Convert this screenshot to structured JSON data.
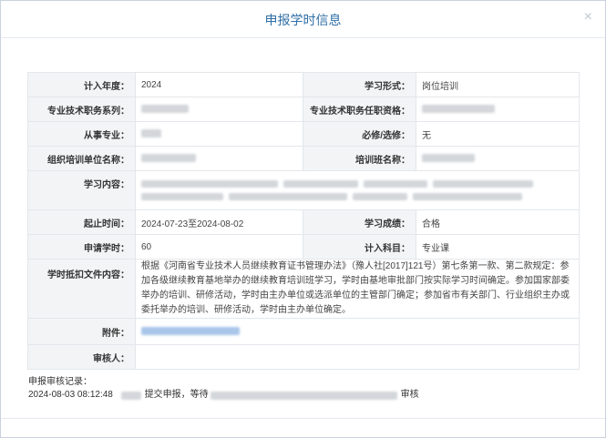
{
  "dialog": {
    "title": "申报学时信息",
    "close_glyph": "×"
  },
  "fields": {
    "year_label": "计入年度：",
    "year_value": "2024",
    "study_form_label": "学习形式：",
    "study_form_value": "岗位培训",
    "tech_series_label": "专业技术职务系列：",
    "tech_qual_label": "专业技术职务任职资格：",
    "major_label": "从事专业：",
    "required_label": "必修/选修：",
    "required_value": "无",
    "org_label": "组织培训单位名称：",
    "class_label": "培训班名称：",
    "content_label": "学习内容：",
    "period_label": "起止时间：",
    "period_value": "2024-07-23至2024-08-02",
    "result_label": "学习成绩：",
    "result_value": "合格",
    "hours_label": "申请学时：",
    "hours_value": "60",
    "subject_label": "计入科目：",
    "subject_value": "专业课",
    "basis_label": "学时抵扣文件内容：",
    "basis_value": "根据《河南省专业技术人员继续教育证书管理办法》（豫人社[2017]121号）第七条第一款、第二款规定：参加各级继续教育基地举办的继续教育培训班学习，学时由基地审批部门按实际学习时间确定。参加国家部委举办的培训、研修活动，学时由主办单位或选派单位的主管部门确定；参加省市有关部门、行业组织主办或委托举办的培训、研修活动，学时由主办单位确定。",
    "attachment_label": "附件：",
    "reviewer_label": "审核人："
  },
  "record": {
    "heading": "申报审核记录：",
    "time": "2024-08-03 08:12:48",
    "submit_text": "提交申报，等待",
    "audit_text": "审核"
  }
}
